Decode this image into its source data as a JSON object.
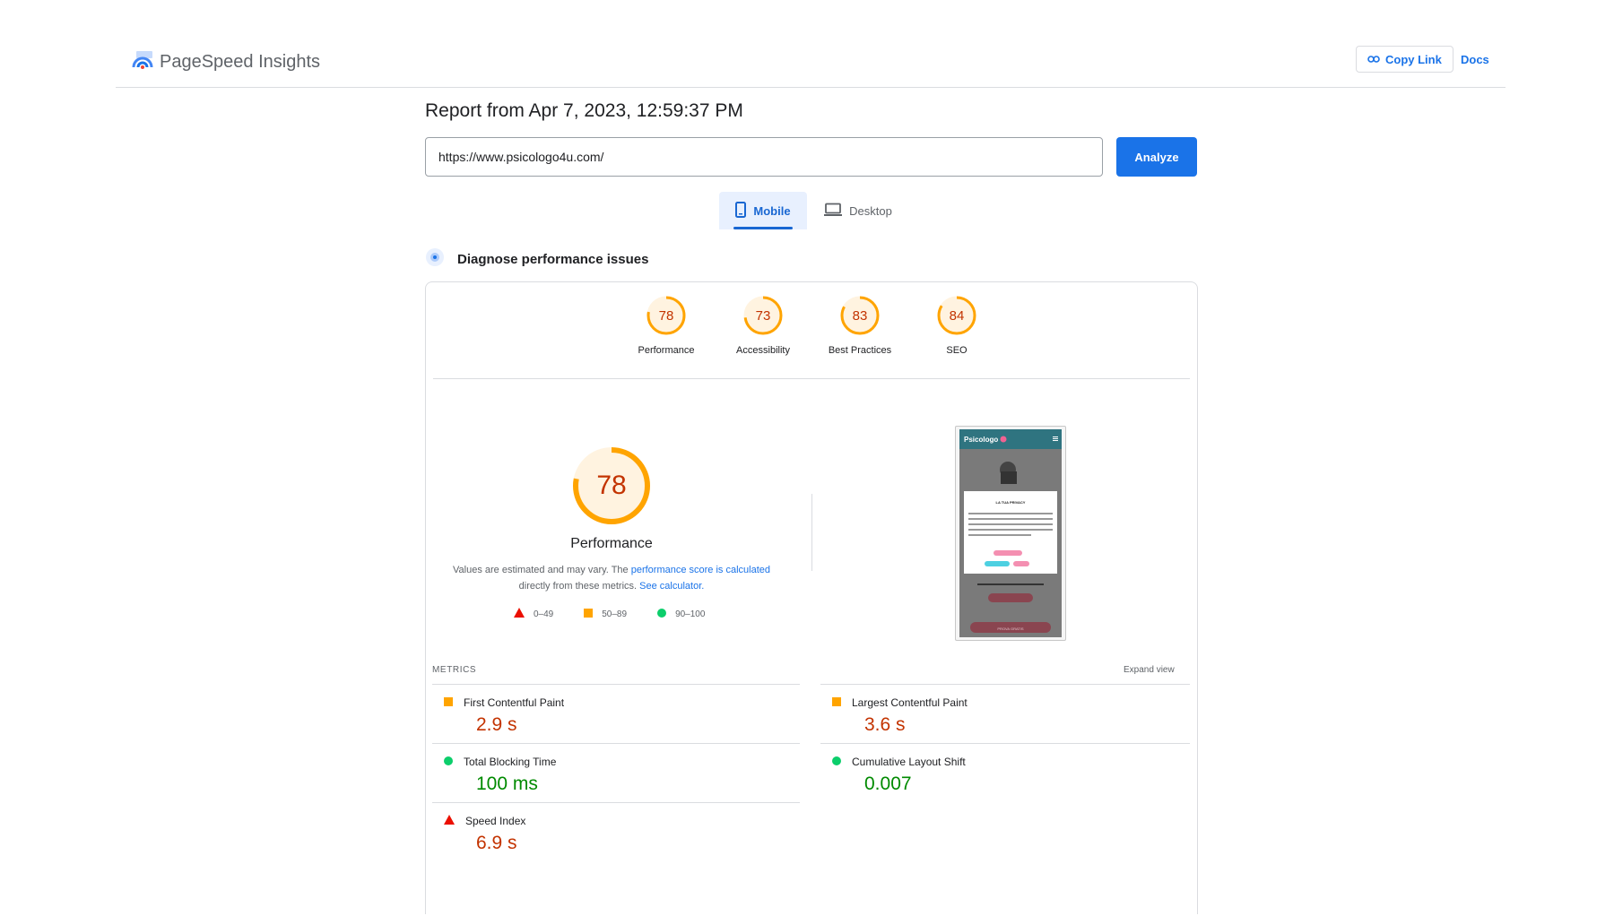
{
  "header": {
    "app_title": "PageSpeed Insights",
    "copy_link_label": "Copy Link",
    "docs_label": "Docs"
  },
  "report": {
    "title": "Report from Apr 7, 2023, 12:59:37 PM",
    "url_value": "https://www.psicologo4u.com/",
    "analyze_label": "Analyze"
  },
  "tabs": {
    "mobile_label": "Mobile",
    "desktop_label": "Desktop",
    "active": "Mobile"
  },
  "diagnose_label": "Diagnose performance issues",
  "scores": [
    {
      "label": "Performance",
      "value": "78",
      "fraction": 0.78
    },
    {
      "label": "Accessibility",
      "value": "73",
      "fraction": 0.73
    },
    {
      "label": "Best Practices",
      "value": "83",
      "fraction": 0.83
    },
    {
      "label": "SEO",
      "value": "84",
      "fraction": 0.84
    }
  ],
  "performance": {
    "score": "78",
    "fraction": 0.78,
    "label": "Performance",
    "note_prefix": "Values are estimated and may vary. The ",
    "note_link1": "performance score is calculated",
    "note_middle": " directly from these metrics. ",
    "note_link2": "See calculator."
  },
  "legend": {
    "fail": "0–49",
    "average": "50–89",
    "pass": "90–100"
  },
  "metrics": {
    "title": "METRICS",
    "expand_label": "Expand view",
    "fcp": {
      "name": "First Contentful Paint",
      "value": "2.9 s",
      "status": "average"
    },
    "lcp": {
      "name": "Largest Contentful Paint",
      "value": "3.6 s",
      "status": "average"
    },
    "tbt": {
      "name": "Total Blocking Time",
      "value": "100 ms",
      "status": "pass"
    },
    "cls": {
      "name": "Cumulative Layout Shift",
      "value": "0.007",
      "status": "pass"
    },
    "si": {
      "name": "Speed Index",
      "value": "6.9 s",
      "status": "fail"
    }
  },
  "screenshot": {
    "brand": "Psicologo",
    "privacy_title": "LA TUA PRIVACY",
    "cta_label": "PROVA GRATIS"
  },
  "colors": {
    "accent": "#1a73e8",
    "fail": "#eb0f00",
    "average": "#ffa400",
    "pass": "#0cce6b"
  }
}
